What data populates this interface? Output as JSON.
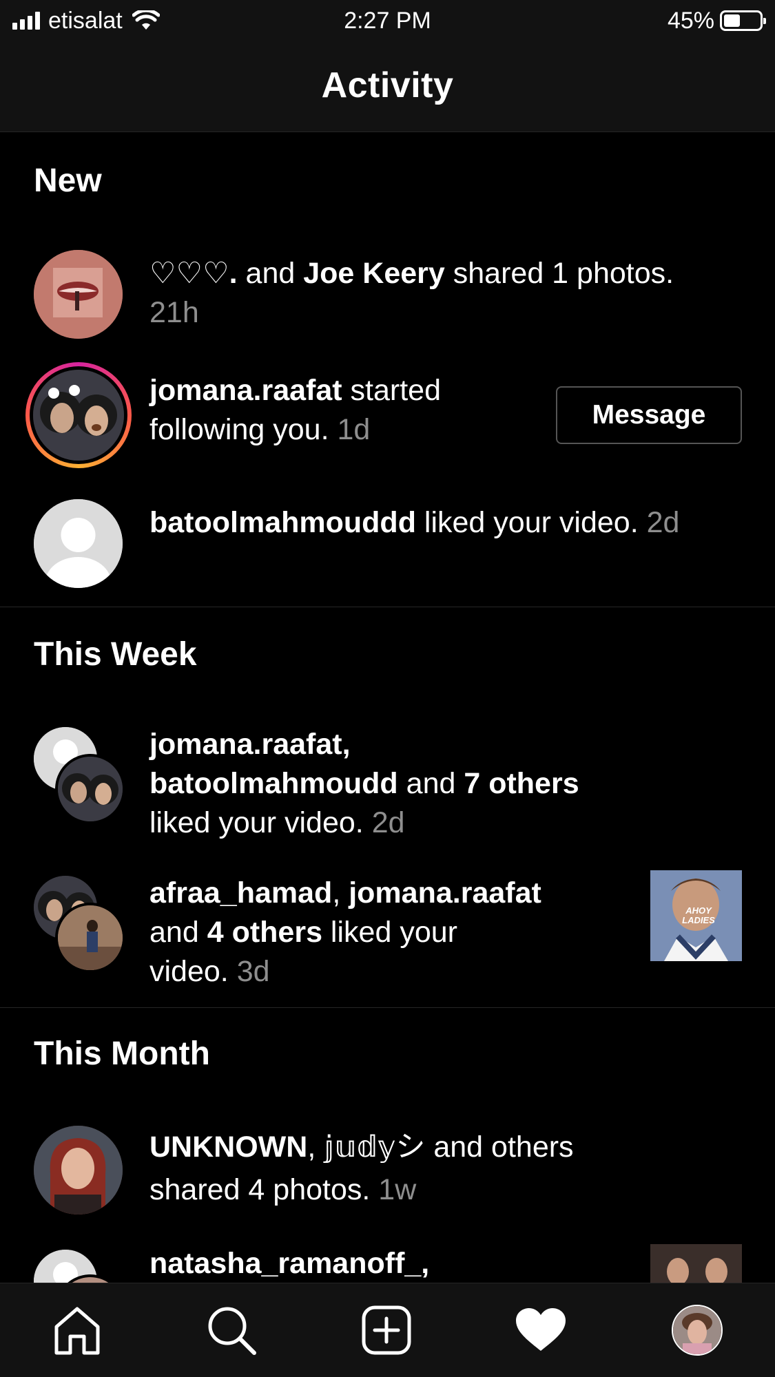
{
  "status_bar": {
    "carrier": "etisalat",
    "time": "2:27 PM",
    "battery": "45%",
    "battery_level": 0.45
  },
  "header": {
    "title": "Activity"
  },
  "sections": {
    "new": {
      "title": "New",
      "items": [
        {
          "actor1": "♡♡♡.",
          "joiner": " and ",
          "actor2": "Joe Keery",
          "action": " shared 1 photos.",
          "time": "21h"
        },
        {
          "actor1": "jomana.raafat",
          "action": " started following you.",
          "time": "1d",
          "button": "Message"
        },
        {
          "actor1": "batoolmahmouddd",
          "action": " liked your video.",
          "time": "2d"
        }
      ]
    },
    "this_week": {
      "title": "This Week",
      "items": [
        {
          "actor1": "jomana.raafat,",
          "actor2": "batoolmahmoudd",
          "joiner": " and ",
          "others": "7 others",
          "action": "liked your video.",
          "time": "2d"
        },
        {
          "actor1": "afraa_hamad",
          "sep": ", ",
          "actor2": "jomana.raafat",
          "joiner": "and ",
          "others": "4 others",
          "action": " liked your",
          "action2": "video.",
          "time": "3d",
          "thumb_text": "AHOY LADIES"
        }
      ]
    },
    "this_month": {
      "title": "This Month",
      "items": [
        {
          "actor1": "UNKNOWN",
          "sep": ", ",
          "actor2": "𝕛𝕦𝕕𝕪シ",
          "action": " and others",
          "action2": "shared 4 photos.",
          "time": "1w"
        },
        {
          "actor1": "natasha_ramanoff_,"
        }
      ]
    }
  },
  "tabbar": {
    "tabs": [
      "home-icon",
      "search-icon",
      "add-post-icon",
      "activity-heart-icon",
      "profile-avatar"
    ]
  }
}
